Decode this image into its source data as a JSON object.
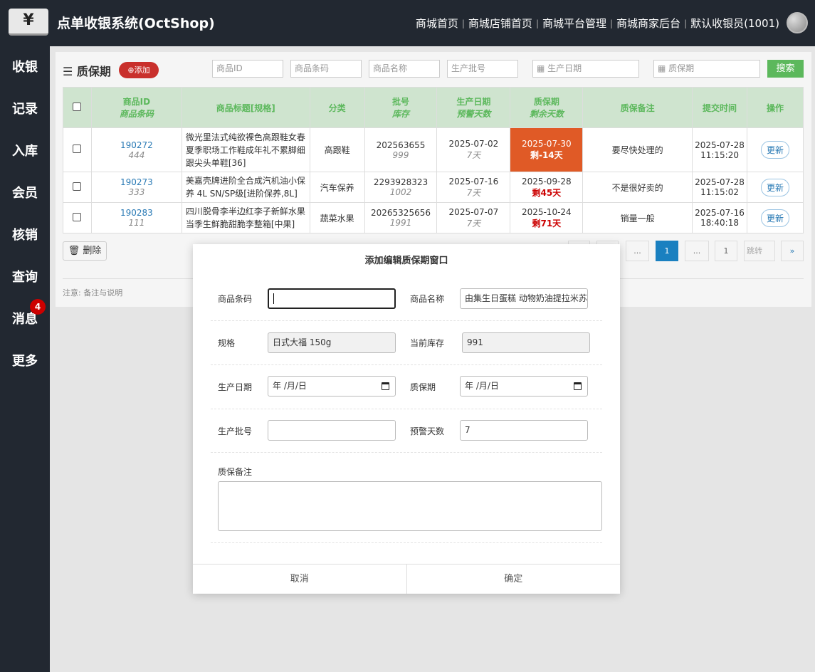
{
  "app": {
    "logo_glyph": "¥",
    "title": "点单收银系统(OctShop)"
  },
  "topnav": [
    "商城首页",
    "商城店铺首页",
    "商城平台管理",
    "商城商家后台",
    "默认收银员(1001)"
  ],
  "sidebar": [
    {
      "label": "收银"
    },
    {
      "label": "记录"
    },
    {
      "label": "入库"
    },
    {
      "label": "会员"
    },
    {
      "label": "核销"
    },
    {
      "label": "查询"
    },
    {
      "label": "消息",
      "badge": "4"
    },
    {
      "label": "更多"
    }
  ],
  "toolbar": {
    "title": "质保期",
    "add_label": "添加",
    "ph_id": "商品ID",
    "ph_barcode": "商品条码",
    "ph_name": "商品名称",
    "ph_batch": "生产批号",
    "ph_mfg": "生产日期",
    "ph_warranty": "质保期",
    "search_label": "搜索"
  },
  "table": {
    "headers": {
      "id": "商品ID",
      "id_sub": "商品条码",
      "title": "商品标题[规格]",
      "cat": "分类",
      "batch": "批号",
      "batch_sub": "库存",
      "mfg": "生产日期",
      "mfg_sub": "预警天数",
      "exp": "质保期",
      "exp_sub": "剩余天数",
      "note": "质保备注",
      "submit": "提交时间",
      "op": "操作"
    },
    "rows": [
      {
        "id": "190272",
        "barcode": "444",
        "title": "微光里法式纯欲裸色高跟鞋女春夏季职场工作鞋成年礼不累脚细跟尖头单鞋[36]",
        "cat": "高跟鞋",
        "batch": "202563655",
        "stock": "999",
        "mfg": "2025-07-02",
        "warn": "7天",
        "exp": "2025-07-30",
        "remain": "剩-14天",
        "note": "要尽快处理的",
        "submit": "2025-07-28 11:15:20",
        "op": "更新"
      },
      {
        "id": "190273",
        "barcode": "333",
        "title": "美嘉壳牌进阶全合成汽机油小保养 4L SN/SP级[进阶保养,8L]",
        "cat": "汽车保养",
        "batch": "2293928323",
        "stock": "1002",
        "mfg": "2025-07-16",
        "warn": "7天",
        "exp": "2025-09-28",
        "remain": "剩45天",
        "note": "不是很好卖的",
        "submit": "2025-07-28 11:15:02",
        "op": "更新"
      },
      {
        "id": "190283",
        "barcode": "111",
        "title": "四川脱骨李半边红李子新鲜水果当季生鲜脆甜脆李整箱[中果]",
        "cat": "蔬菜水果",
        "batch": "20265325656",
        "stock": "1991",
        "mfg": "2025-07-07",
        "warn": "7天",
        "exp": "2025-10-24",
        "remain": "剩71天",
        "note": "销量一般",
        "submit": "2025-07-16 18:40:18",
        "op": "更新"
      }
    ]
  },
  "footer": {
    "delete_label": "删除",
    "pager": [
      "...",
      "1",
      "...",
      "1"
    ],
    "jump_placeholder": "跳转",
    "next": "»",
    "note": "注意: 备注与说明"
  },
  "dialog": {
    "title": "添加编辑质保期窗口",
    "barcode_label": "商品条码",
    "barcode_value": "",
    "name_label": "商品名称",
    "name_value": "由集生日蛋糕 动物奶油提拉米苏",
    "spec_label": "规格",
    "spec_value": "日式大福 150g",
    "stock_label": "当前库存",
    "stock_value": "991",
    "mfg_label": "生产日期",
    "mfg_value": "年 /月/日",
    "warranty_label": "质保期",
    "warranty_value": "年 /月/日",
    "batch_label": "生产批号",
    "batch_value": "",
    "warn_label": "预警天数",
    "warn_value": "7",
    "remark_label": "质保备注",
    "cancel_label": "取消",
    "ok_label": "确定"
  }
}
